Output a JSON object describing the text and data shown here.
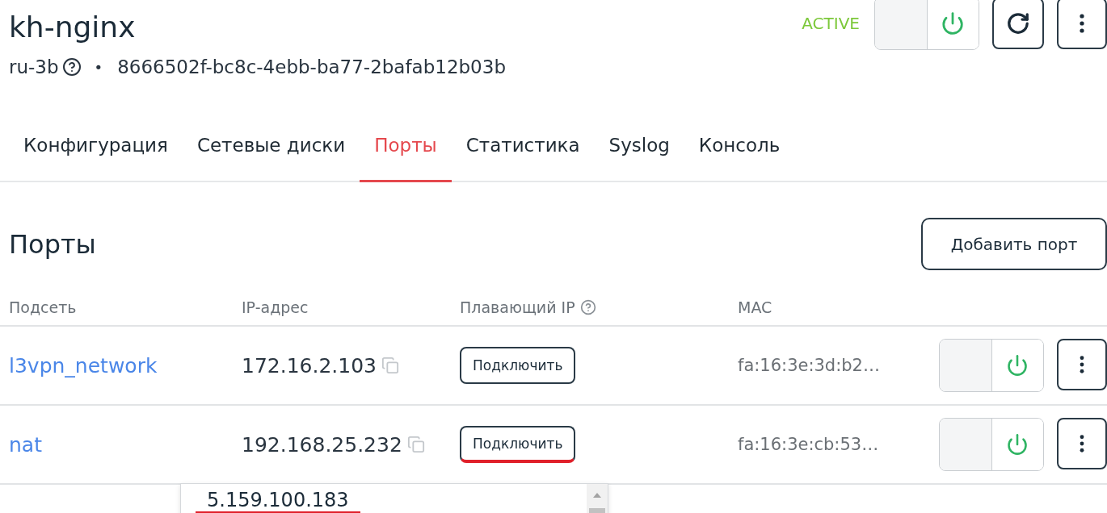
{
  "server": {
    "name": "kh-nginx",
    "region": "ru-3b",
    "separator": "•",
    "id": "8666502f-bc8c-4ebb-ba77-2bafab12b03b",
    "status": "ACTIVE",
    "power_on": true
  },
  "tabs": [
    {
      "label": "Конфигурация",
      "selected": false
    },
    {
      "label": "Сетевые диски",
      "selected": false
    },
    {
      "label": "Порты",
      "selected": true
    },
    {
      "label": "Статистика",
      "selected": false
    },
    {
      "label": "Syslog",
      "selected": false
    },
    {
      "label": "Консоль",
      "selected": false
    }
  ],
  "section": {
    "title": "Порты",
    "add_button": "Добавить порт"
  },
  "table": {
    "columns": [
      "Подсеть",
      "IP-адрес",
      "Плавающий IP",
      "MAC"
    ],
    "rows": [
      {
        "subnet": "l3vpn_network",
        "ip": "172.16.2.103",
        "action": "Подключить",
        "underlined": false,
        "mac": "fa:16:3e:3d:b2…",
        "on": true
      },
      {
        "subnet": "nat",
        "ip": "192.168.25.232",
        "action": "Подключить",
        "underlined": true,
        "mac": "fa:16:3e:cb:53…",
        "on": true
      }
    ]
  },
  "dropdown": {
    "options": [
      {
        "label": "5.159.100.183",
        "underlined": true
      }
    ]
  }
}
